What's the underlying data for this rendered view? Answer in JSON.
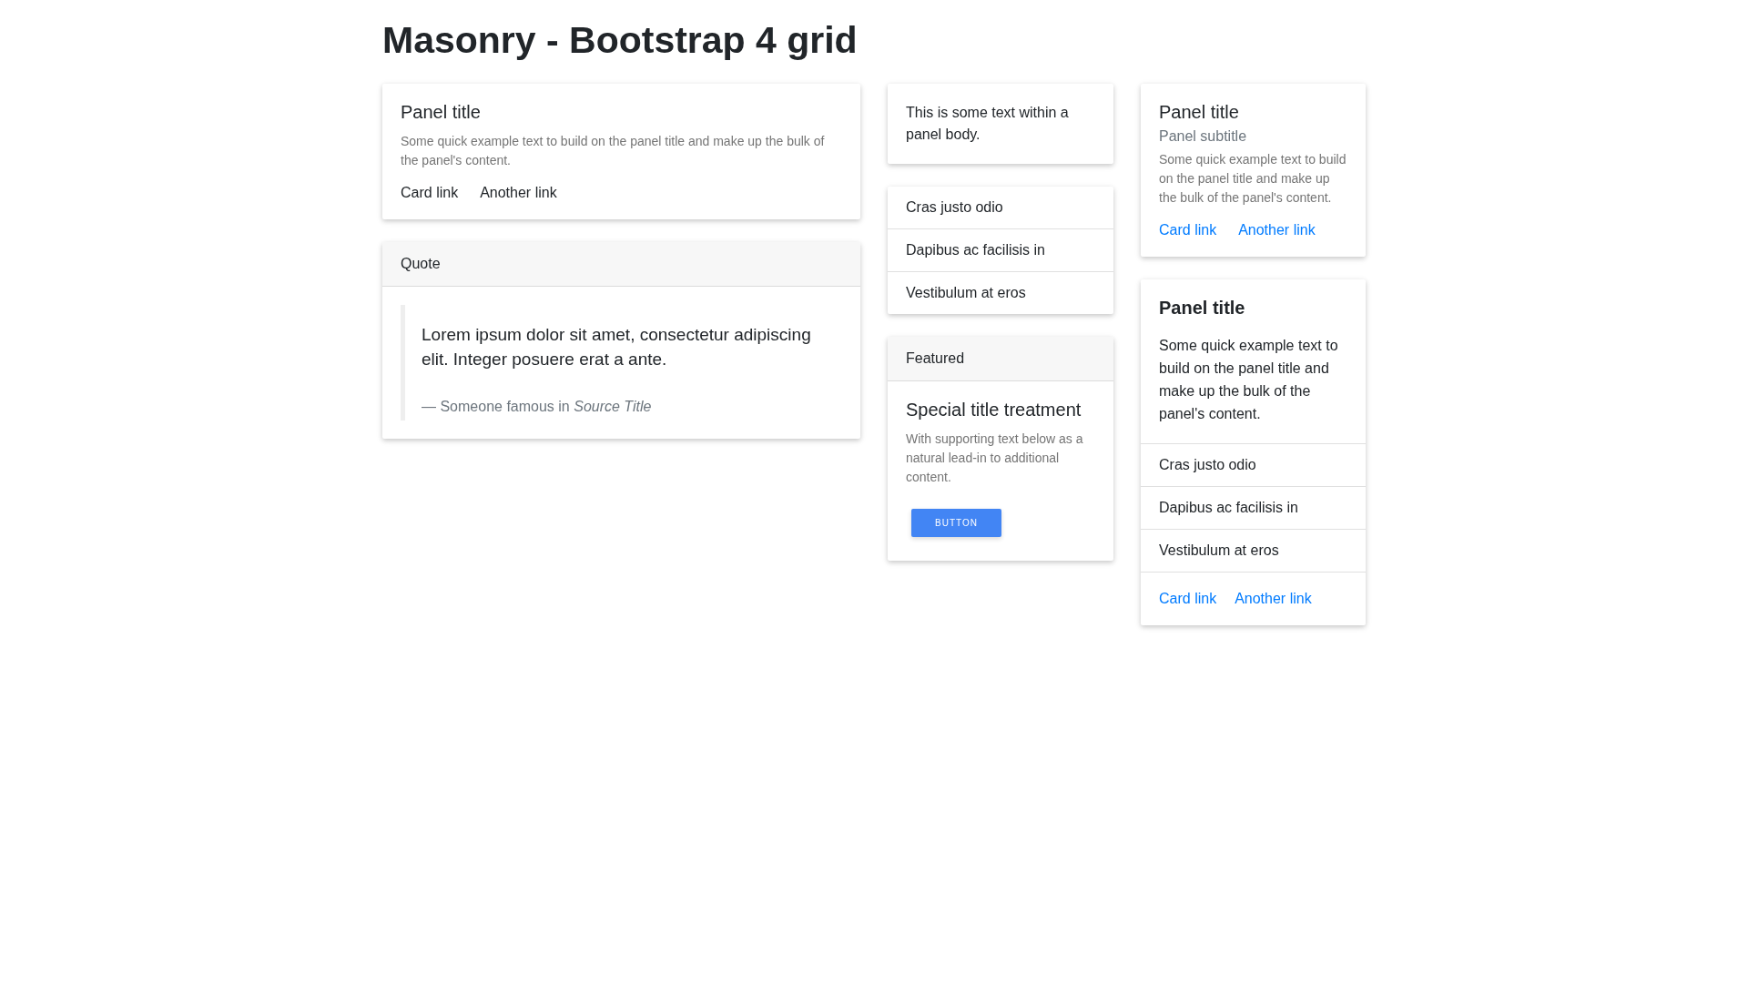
{
  "page_title": "Masonry - Bootstrap 4 grid",
  "columns": [
    {
      "panels": [
        {
          "kind": "text",
          "title": "Panel title",
          "text": "Some quick example text to build on the panel title and make up the bulk of the panel's content.",
          "links": {
            "kind": "plain",
            "items": [
              "Card link",
              "Another link"
            ]
          }
        },
        {
          "kind": "quote",
          "header": "Quote",
          "quote": "Lorem ipsum dolor sit amet, consectetur adipiscing elit. Integer posuere erat a ante.",
          "footer": "— Someone famous in *Source Title*"
        }
      ]
    },
    {
      "panels": [
        {
          "kind": "body",
          "body": "This is some text within a panel body."
        },
        {
          "kind": "list",
          "list": [
            "Cras justo odio",
            "Dapibus ac facilisis in",
            "Vestibulum at eros"
          ]
        },
        {
          "kind": "featured",
          "header": "Featured",
          "title": "Special title treatment",
          "text": "With supporting text below as a natural lead-in to additional content.",
          "button": "BUTTON"
        }
      ]
    },
    {
      "panels": [
        {
          "kind": "text",
          "title": "Panel title",
          "subtitle": "Panel subtitle",
          "text": "Some quick example text to build on the panel title and make up the bulk of the panel's content.",
          "links": {
            "kind": "accent",
            "items": [
              "Card link",
              "Another link"
            ]
          }
        },
        {
          "kind": "full",
          "title": "Panel title",
          "body": "Some quick example text to build on the panel title and make up the bulk of the panel's content.",
          "list": [
            "Cras justo odio",
            "Dapibus ac facilisis in",
            "Vestibulum at eros"
          ],
          "links": {
            "kind": "accent",
            "items": [
              "Card link",
              "Another link"
            ]
          }
        }
      ]
    }
  ]
}
